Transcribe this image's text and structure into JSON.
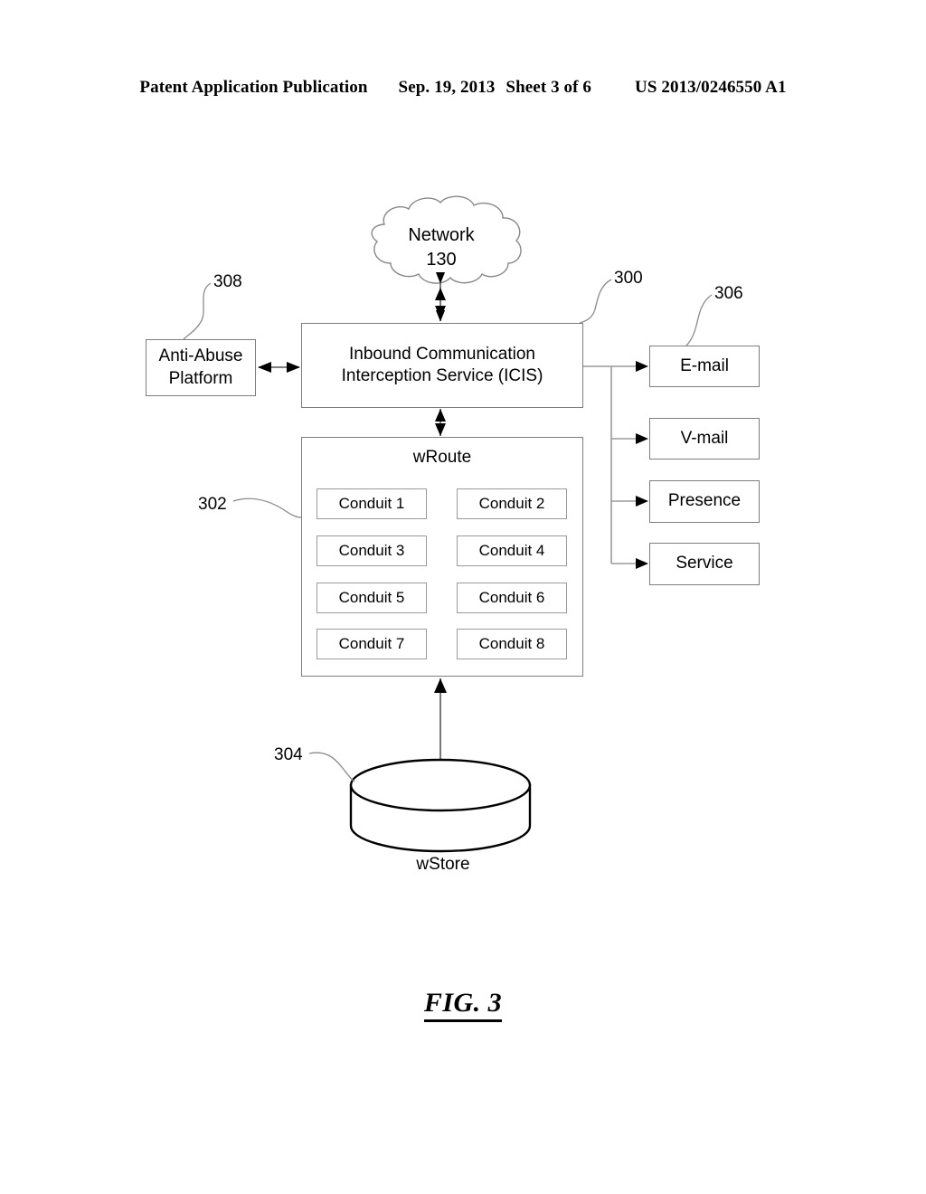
{
  "header": {
    "publication": "Patent Application Publication",
    "date": "Sep. 19, 2013",
    "sheet": "Sheet 3 of 6",
    "patent_number": "US 2013/0246550 A1"
  },
  "figure": {
    "caption": "FIG. 3",
    "cloud": {
      "name": "Network",
      "reference": "130",
      "label": "Network\n130"
    },
    "nodes": {
      "anti_abuse_platform": "Anti-Abuse Platform",
      "anti_abuse_platform_line1": "Anti-Abuse",
      "anti_abuse_platform_line2": "Platform",
      "icis_line1": "Inbound Communication",
      "icis_line2": "Interception Service (ICIS)",
      "wroute": "wRoute",
      "wstore": "wStore"
    },
    "conduits": [
      "Conduit 1",
      "Conduit 2",
      "Conduit 3",
      "Conduit 4",
      "Conduit 5",
      "Conduit 6",
      "Conduit 7",
      "Conduit 8"
    ],
    "outputs": [
      "E-mail",
      "V-mail",
      "Presence",
      "Service"
    ],
    "reference_numerals": {
      "icis": "300",
      "wroute": "302",
      "wstore": "304",
      "outputs": "306",
      "anti_abuse_platform": "308"
    },
    "colors": {
      "line": "#7d7d7d",
      "conduit_line": "#9a9a9a",
      "arrow": "#000000",
      "text": "#000000",
      "background": "#ffffff"
    }
  }
}
